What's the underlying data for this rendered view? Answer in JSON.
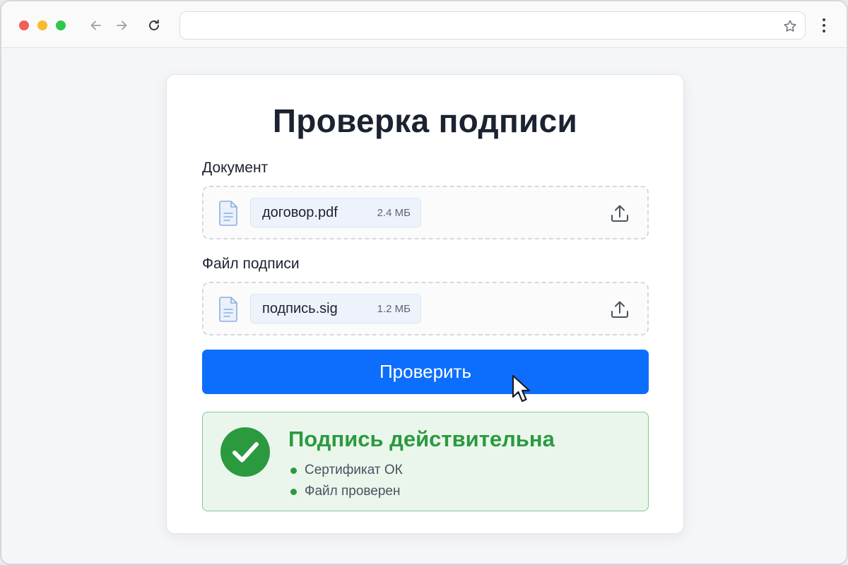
{
  "browser": {
    "url": "",
    "buttons": {
      "back": "back-arrow-icon",
      "forward": "forward-arrow-icon",
      "reload": "reload-icon",
      "bookmark": "star-icon",
      "menu": "kebab-menu-icon"
    }
  },
  "page": {
    "title": "Проверка подписи",
    "document": {
      "label": "Документ",
      "file_name": "договор.pdf",
      "file_size": "2.4 МБ"
    },
    "signature": {
      "label": "Файл подписи",
      "file_name": "подпись.sig",
      "file_size": "1.2 МБ"
    },
    "verify_button": "Проверить",
    "result": {
      "status": "valid",
      "title": "Подпись действительна",
      "items": [
        "Сертификат ОК",
        "Файл проверен"
      ]
    }
  },
  "colors": {
    "accent": "#0d6efd",
    "success": "#2b9a3f",
    "success_bg": "#eaf6ec"
  }
}
